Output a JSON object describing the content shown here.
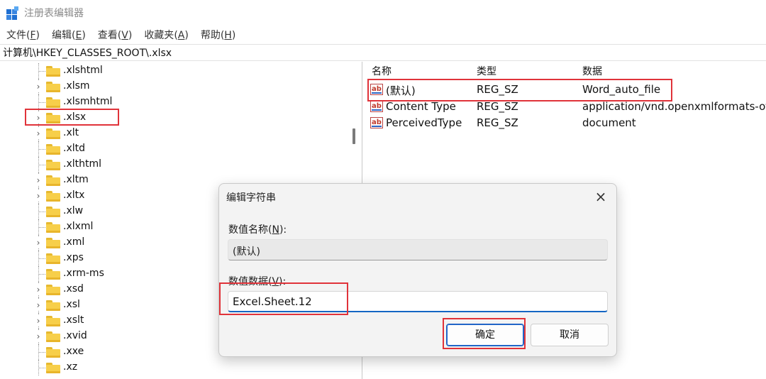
{
  "window": {
    "title": "注册表编辑器"
  },
  "menu": {
    "items": [
      {
        "label": "文件",
        "key": "F"
      },
      {
        "label": "编辑",
        "key": "E"
      },
      {
        "label": "查看",
        "key": "V"
      },
      {
        "label": "收藏夹",
        "key": "A"
      },
      {
        "label": "帮助",
        "key": "H"
      }
    ]
  },
  "address": {
    "path": "计算机\\HKEY_CLASSES_ROOT\\.xlsx"
  },
  "tree": {
    "items": [
      {
        "label": ".xlshtml",
        "expandable": false
      },
      {
        "label": ".xlsm",
        "expandable": true
      },
      {
        "label": ".xlsmhtml",
        "expandable": false
      },
      {
        "label": ".xlsx",
        "expandable": true,
        "selected": true
      },
      {
        "label": ".xlt",
        "expandable": true
      },
      {
        "label": ".xltd",
        "expandable": false
      },
      {
        "label": ".xlthtml",
        "expandable": false
      },
      {
        "label": ".xltm",
        "expandable": true
      },
      {
        "label": ".xltx",
        "expandable": true
      },
      {
        "label": ".xlw",
        "expandable": false
      },
      {
        "label": ".xlxml",
        "expandable": false
      },
      {
        "label": ".xml",
        "expandable": true
      },
      {
        "label": ".xps",
        "expandable": false
      },
      {
        "label": ".xrm-ms",
        "expandable": false
      },
      {
        "label": ".xsd",
        "expandable": true
      },
      {
        "label": ".xsl",
        "expandable": true
      },
      {
        "label": ".xslt",
        "expandable": true
      },
      {
        "label": ".xvid",
        "expandable": true
      },
      {
        "label": ".xxe",
        "expandable": false
      },
      {
        "label": ".xz",
        "expandable": false
      }
    ]
  },
  "values": {
    "headers": {
      "name": "名称",
      "type": "类型",
      "data": "数据"
    },
    "rows": [
      {
        "name": "(默认)",
        "type": "REG_SZ",
        "data": "Word_auto_file"
      },
      {
        "name": "Content Type",
        "type": "REG_SZ",
        "data": "application/vnd.openxmlformats-of"
      },
      {
        "name": "PerceivedType",
        "type": "REG_SZ",
        "data": "document"
      }
    ]
  },
  "dialog": {
    "title": "编辑字符串",
    "close_icon": "×",
    "name_label": "数值名称",
    "name_key": "N",
    "name_value": "(默认)",
    "data_label": "数值数据",
    "data_key": "V",
    "data_value": "Excel.Sheet.12",
    "ok_label": "确定",
    "cancel_label": "取消"
  },
  "colors": {
    "highlight": "#e0333a",
    "accent": "#1466c3",
    "folder": "#f7cf4a"
  },
  "icons": {
    "value_icon": "ab-string-value-icon",
    "folder_icon": "folder-icon",
    "app_icon": "regedit-icon"
  }
}
